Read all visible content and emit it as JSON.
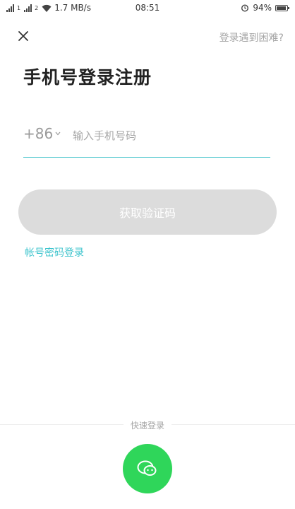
{
  "status_bar": {
    "sim1": "1",
    "sim2": "2",
    "network_speed": "1.7 MB/s",
    "time": "08:51",
    "battery_percent": "94%",
    "battery_level": 0.94
  },
  "header": {
    "close_icon": "close-icon",
    "trouble_link": "登录遇到困难?"
  },
  "title": "手机号登录注册",
  "phone": {
    "country_code": "+86",
    "placeholder": "输入手机号码",
    "value": ""
  },
  "get_code_button": "获取验证码",
  "account_login_link": "帐号密码登录",
  "quick_login": {
    "label": "快速登录",
    "icon": "wechat-icon"
  },
  "colors": {
    "accent": "#3ec4cd",
    "disabled_button": "#dcdcdc",
    "wechat_green": "#2fd65a"
  }
}
